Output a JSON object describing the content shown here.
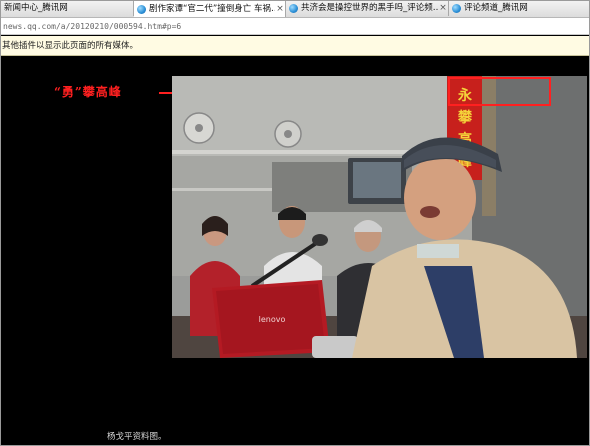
{
  "browser": {
    "tabs": [
      {
        "title": "新闻中心_腾讯网",
        "active": false,
        "has_close": false
      },
      {
        "title": "剧作家谭“官二代”撞倒身亡 车祸…",
        "active": true,
        "has_close": true
      },
      {
        "title": "共济会是操控世界的黑手吗_评论频…",
        "active": false,
        "has_close": true
      },
      {
        "title": "评论频道_腾讯网",
        "active": false,
        "has_close": false
      }
    ],
    "close_glyph": "×",
    "address": "news.qq.com/a/20120210/000594.htm#p=6",
    "plugin_notice": "其他插件以显示此页面的所有媒体。"
  },
  "page": {
    "annotation": "“勇”攀高峰",
    "annotation_color": "#ff2020",
    "photo_banner_chars": [
      "永",
      "攀",
      "高",
      "峰"
    ],
    "laptop_brand": "lenovo",
    "caption": "杨戈平资料图。"
  }
}
